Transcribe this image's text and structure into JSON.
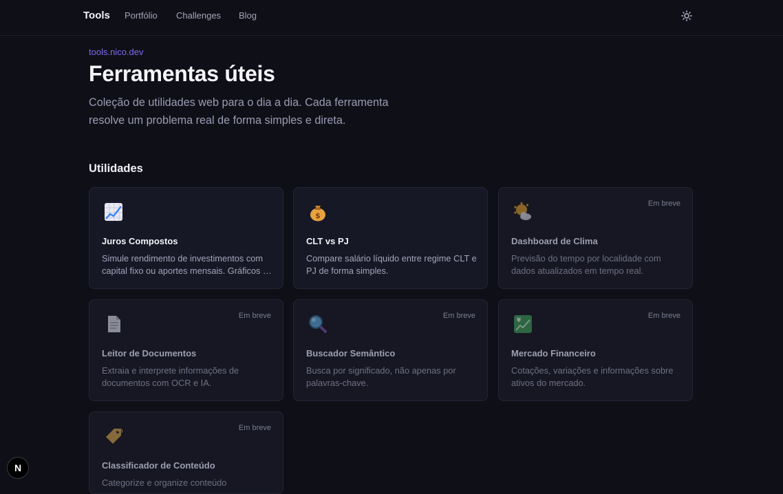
{
  "nav": {
    "brand": "Tools",
    "links": [
      "Portfólio",
      "Challenges",
      "Blog"
    ],
    "theme_icon": "sun-icon"
  },
  "hero": {
    "eyebrow": "tools.nico.dev",
    "title": "Ferramentas úteis",
    "subtitle": "Coleção de utilidades web para o dia a dia. Cada ferramenta resolve um problema real de forma simples e direta."
  },
  "section": {
    "title": "Utilidades"
  },
  "cards": [
    {
      "icon": "chart-increasing-icon",
      "title": "Juros Compostos",
      "desc": "Simule rendimento de investimentos com capital fixo ou aportes mensais. Gráficos e tabela detalhada.",
      "badge": ""
    },
    {
      "icon": "money-bag-icon",
      "title": "CLT vs PJ",
      "desc": "Compare salário líquido entre regime CLT e PJ de forma simples.",
      "badge": ""
    },
    {
      "icon": "sun-behind-cloud-icon",
      "title": "Dashboard de Clima",
      "desc": "Previsão do tempo por localidade com dados atualizados em tempo real.",
      "badge": "Em breve"
    },
    {
      "icon": "document-icon",
      "title": "Leitor de Documentos",
      "desc": "Extraia e interprete informações de documentos com OCR e IA.",
      "badge": "Em breve"
    },
    {
      "icon": "magnifying-glass-icon",
      "title": "Buscador Semântico",
      "desc": "Busca por significado, não apenas por palavras-chave.",
      "badge": "Em breve"
    },
    {
      "icon": "chart-yen-icon",
      "title": "Mercado Financeiro",
      "desc": "Cotações, variações e informações sobre ativos do mercado.",
      "badge": "Em breve"
    },
    {
      "icon": "label-tag-icon",
      "title": "Classificador de Conteúdo",
      "desc": "Categorize e organize conteúdo",
      "badge": "Em breve"
    }
  ],
  "dev_badge": {
    "label": "N"
  }
}
